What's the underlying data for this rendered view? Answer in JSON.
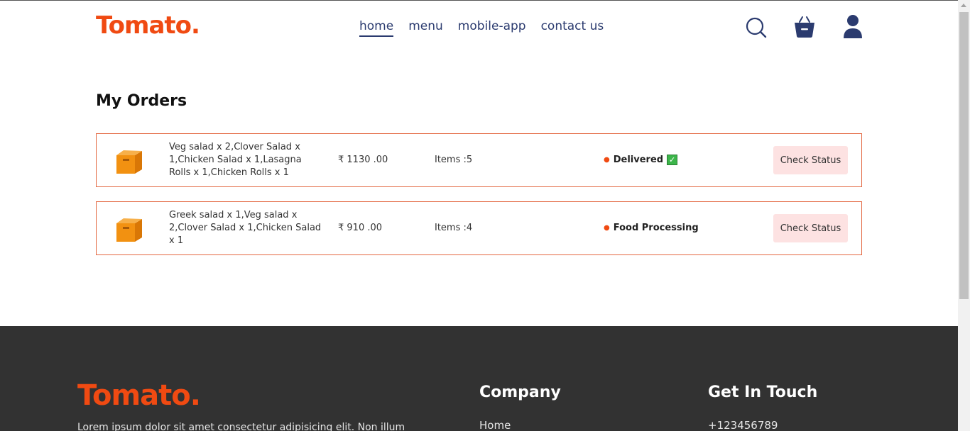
{
  "header": {
    "logo": "Tomato.",
    "nav": [
      "home",
      "menu",
      "mobile-app",
      "contact us"
    ],
    "active_nav": "home"
  },
  "page_title": "My Orders",
  "orders": [
    {
      "items": "Veg salad x 2,Clover Salad x 1,Chicken Salad x 1,Lasagna Rolls x 1,Chicken Rolls x 1",
      "amount": "₹ 1130 .00",
      "count": "Items :5",
      "status": "Delivered",
      "status_emoji": "✓",
      "button": "Check Status"
    },
    {
      "items": "Greek salad x 1,Veg salad x 2,Clover Salad x 1,Chicken Salad x 1",
      "amount": "₹ 910 .00",
      "count": "Items :4",
      "status": "Food Processing",
      "button": "Check Status"
    }
  ],
  "footer": {
    "logo": "Tomato.",
    "description": "Lorem ipsum dolor sit amet consectetur adipisicing elit. Non illum",
    "company_heading": "Company",
    "company_links": [
      "Home"
    ],
    "contact_heading": "Get In Touch",
    "phone": "+123456789"
  },
  "colors": {
    "brand": "#f04a12",
    "nav": "#2b3b6f",
    "button_bg": "#fde2e2",
    "footer_bg": "#323232"
  },
  "icons": [
    "search-icon",
    "basket-icon",
    "profile-icon",
    "parcel-icon",
    "check-icon"
  ]
}
